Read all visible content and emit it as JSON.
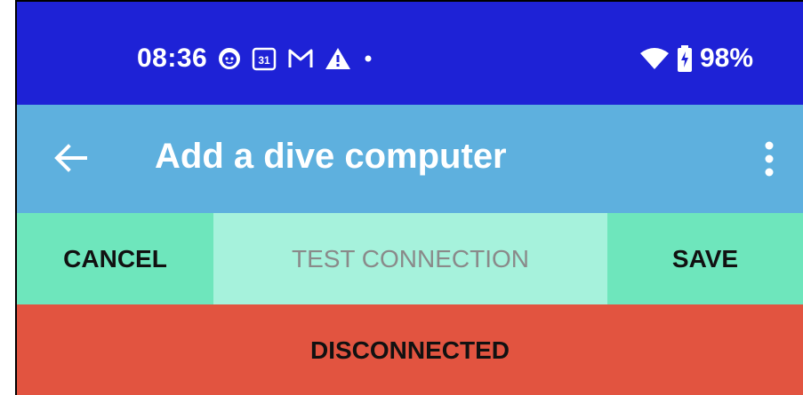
{
  "status_bar": {
    "time": "08:36",
    "calendar_day": "31",
    "battery": "98%",
    "icons": [
      "face-icon",
      "calendar-icon",
      "gmail-icon",
      "warning-icon",
      "dot-icon",
      "wifi-icon",
      "battery-charging-icon"
    ]
  },
  "app_bar": {
    "title": "Add a dive computer",
    "back_icon": "arrow-left-icon",
    "menu_icon": "more-vert-icon"
  },
  "actions": {
    "cancel_label": "CANCEL",
    "test_label": "TEST CONNECTION",
    "save_label": "SAVE"
  },
  "connection": {
    "status": "DISCONNECTED"
  },
  "colors": {
    "status_bar": "#1e22d6",
    "app_bar": "#5eb0de",
    "action_button": "#6ee6bc",
    "action_button_disabled": "#a6f2dc",
    "disconnected": "#e25440"
  }
}
